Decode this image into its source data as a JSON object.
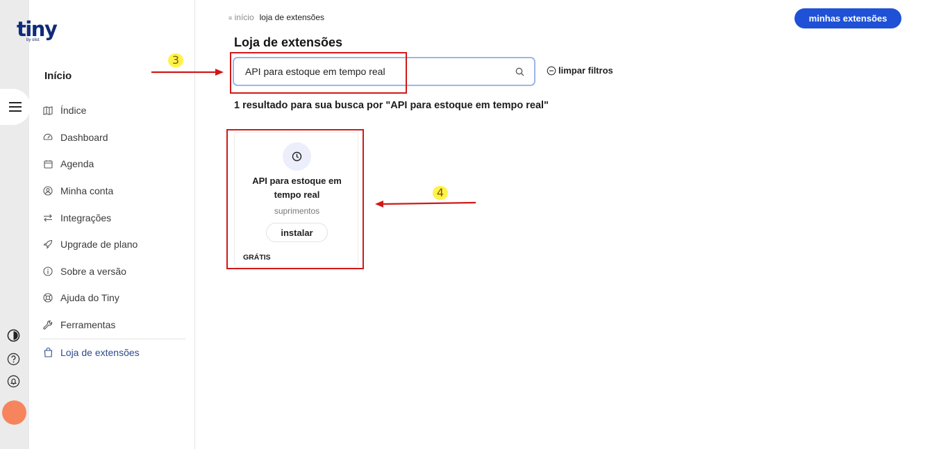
{
  "brand": {
    "name": "tiny",
    "by": "by olist"
  },
  "sidebar": {
    "title": "Início",
    "items": [
      {
        "label": "Índice",
        "icon": "map-icon"
      },
      {
        "label": "Dashboard",
        "icon": "gauge-icon"
      },
      {
        "label": "Agenda",
        "icon": "calendar-icon"
      },
      {
        "label": "Minha conta",
        "icon": "user-circle-icon"
      },
      {
        "label": "Integrações",
        "icon": "arrows-icon"
      },
      {
        "label": "Upgrade de plano",
        "icon": "rocket-icon"
      },
      {
        "label": "Sobre a versão",
        "icon": "info-icon"
      },
      {
        "label": "Ajuda do Tiny",
        "icon": "lifebuoy-icon"
      },
      {
        "label": "Ferramentas",
        "icon": "wrench-icon"
      }
    ],
    "active_item": {
      "label": "Loja de extensões",
      "icon": "shopping-bag-icon"
    }
  },
  "breadcrumb": {
    "home": "início",
    "current": "loja de extensões"
  },
  "header": {
    "primary_button": "minhas extensões"
  },
  "page": {
    "title": "Loja de extensões"
  },
  "search": {
    "value": "API para estoque em tempo real",
    "clear_label": "limpar filtros"
  },
  "results": {
    "summary": "1 resultado para sua busca por \"API para estoque em tempo real\""
  },
  "card": {
    "title": "API para estoque em tempo real",
    "category": "suprimentos",
    "install_label": "instalar",
    "badge": "GRÁTIS",
    "icon": "clock-icon"
  },
  "annotations": {
    "step_search": "3",
    "step_card": "4"
  },
  "colors": {
    "primary": "#1e51d6",
    "annotation": "#d01818",
    "badge_yellow": "#fff34a",
    "avatar": "#f6855d"
  }
}
